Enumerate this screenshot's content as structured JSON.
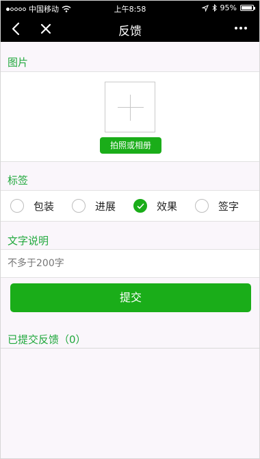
{
  "status_bar": {
    "carrier": "中国移动",
    "time": "上午8:58",
    "battery": "95%",
    "battery_level": 0.95,
    "signal_icon": "signal-dots-icon",
    "wifi_icon": "wifi-icon",
    "location_icon": "location-arrow-icon",
    "bluetooth_icon": "bluetooth-icon"
  },
  "nav": {
    "title": "反馈",
    "back_icon": "chevron-left-icon",
    "close_icon": "close-icon",
    "more_icon": "more-dots-icon"
  },
  "sections": {
    "image": "图片",
    "tags": "标签",
    "description": "文字说明",
    "submitted": "已提交反馈（0）"
  },
  "image_upload": {
    "add_icon": "plus-icon",
    "button_label": "拍照或相册"
  },
  "tags": [
    {
      "label": "包装",
      "checked": false
    },
    {
      "label": "进展",
      "checked": false
    },
    {
      "label": "效果",
      "checked": true
    },
    {
      "label": "签字",
      "checked": false
    }
  ],
  "description": {
    "placeholder": "不多于200字"
  },
  "submit_label": "提交",
  "colors": {
    "accent": "#1aad19",
    "section_title": "#20a83c",
    "background": "#faf6fb",
    "navbar": "#000000"
  }
}
